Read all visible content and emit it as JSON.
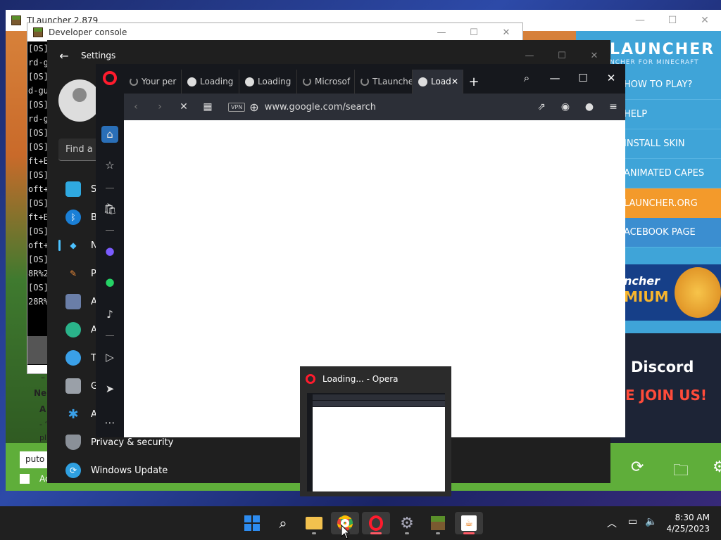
{
  "tlauncher": {
    "title": "TLauncher 2.879",
    "logo": "LAUNCHER",
    "tagline": "NCHER FOR MINECRAFT",
    "menu": [
      "HOW TO PLAY?",
      "HELP",
      "INSTALL SKIN",
      "ANIMATED CAPES",
      "LAUNCHER.ORG",
      "ACEBOOK PAGE"
    ],
    "banner1_title": "ncher",
    "banner1_sub": "MIUM",
    "banner2_title": "Discord",
    "banner2_sub": "E JOIN US!",
    "username_value": "puto",
    "account_label": "Ac"
  },
  "dev_console": {
    "title": "Developer console",
    "lines": [
      "[OS]",
      "rd-g",
      "[OS]",
      "d-gu",
      "[OS]",
      "rd-g",
      "[OS]",
      "[OS]",
      "ft+E",
      "[OS]",
      "oft+",
      "[OS]",
      "ft+E",
      "[OS]",
      "oft+",
      "[OS]",
      "8R%2",
      "[OS]",
      "28R%"
    ]
  },
  "settings": {
    "title": "Settings",
    "find_placeholder": "Find a",
    "items": [
      {
        "label": "Sy",
        "icon": "system-icon"
      },
      {
        "label": "B",
        "icon": "bluetooth-icon"
      },
      {
        "label": "N",
        "icon": "network-icon"
      },
      {
        "label": "P",
        "icon": "personalization-icon"
      },
      {
        "label": "A",
        "icon": "apps-icon"
      },
      {
        "label": "A",
        "icon": "accounts-icon"
      },
      {
        "label": "Ti",
        "icon": "time-icon"
      },
      {
        "label": "G",
        "icon": "gaming-icon"
      },
      {
        "label": "A",
        "icon": "accessibility-icon"
      },
      {
        "label": "Privacy & security",
        "icon": "shield-icon"
      },
      {
        "label": "Windows Update",
        "icon": "update-icon"
      }
    ],
    "left_text": [
      "–",
      "Ne",
      "A",
      "- ‘",
      "pl"
    ]
  },
  "opera": {
    "tabs": [
      {
        "label": "Your per"
      },
      {
        "label": "Loading"
      },
      {
        "label": "Loading"
      },
      {
        "label": "Microsof"
      },
      {
        "label": "TLaunche"
      },
      {
        "label": "Load"
      }
    ],
    "vpn_label": "VPN",
    "url": "www.google.com/search"
  },
  "thumbnail": {
    "title": "Loading... - Opera"
  },
  "taskbar": {
    "time": "8:30 AM",
    "date": "4/25/2023"
  },
  "colors": {
    "opera_red": "#ff1b2d",
    "tlauncher_blue": "#3fa4d8",
    "tlauncher_orange": "#f39a2b",
    "accent_blue": "#4cc2ff"
  }
}
